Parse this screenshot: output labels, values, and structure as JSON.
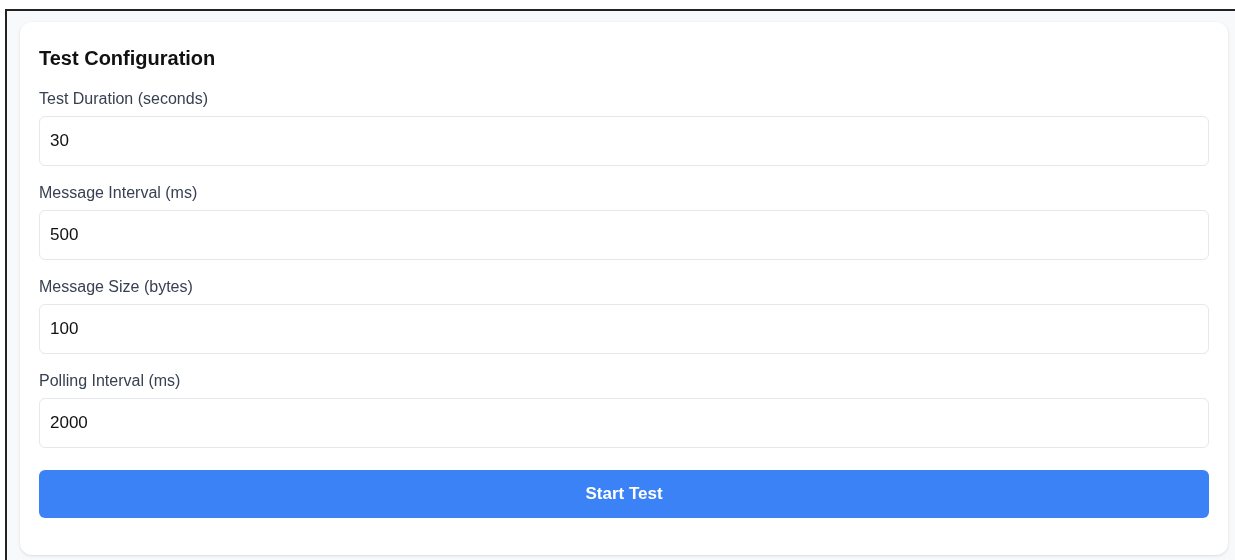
{
  "title": "Test Configuration",
  "fields": [
    {
      "label": "Test Duration (seconds)",
      "value": "30"
    },
    {
      "label": "Message Interval (ms)",
      "value": "500"
    },
    {
      "label": "Message Size (bytes)",
      "value": "100"
    },
    {
      "label": "Polling Interval (ms)",
      "value": "2000"
    }
  ],
  "button": "Start Test"
}
